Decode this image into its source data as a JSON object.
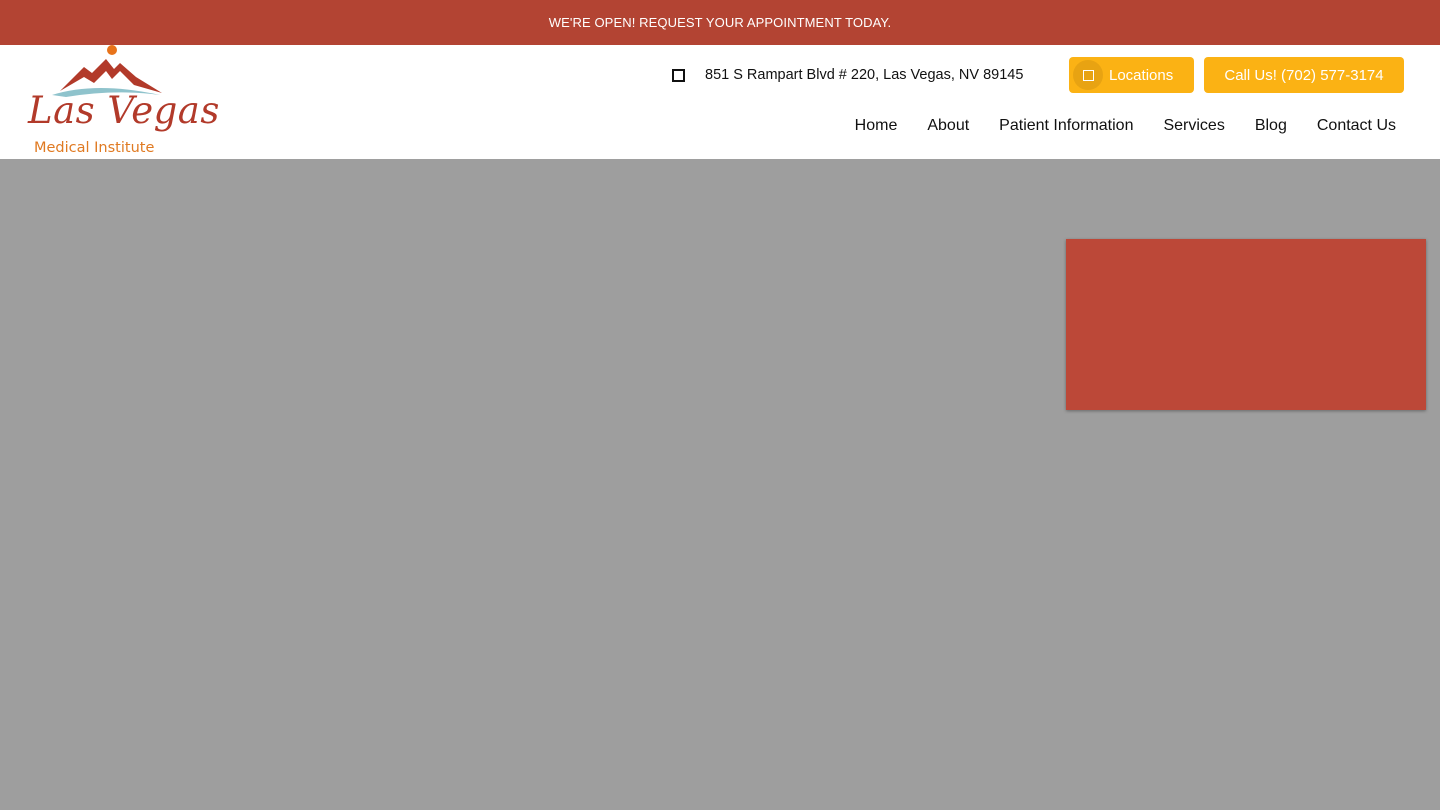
{
  "banner": {
    "text": "WE'RE OPEN! REQUEST YOUR APPOINTMENT TODAY."
  },
  "logo": {
    "script": "Las Vegas",
    "sub": "Medical Institute",
    "colors": {
      "script": "#b23a2a",
      "sub": "#e07a22",
      "mountain": "#b23a2a",
      "wave": "#8fc3cc",
      "sun": "#e8731a"
    }
  },
  "header": {
    "address_icon": "map-marker-icon",
    "address": "851 S Rampart Blvd # 220, Las Vegas, NV 89145",
    "locations_label": "Locations",
    "locations_icon": "location-icon",
    "call_label": "Call Us! (702) 577-3174"
  },
  "nav": {
    "items": [
      {
        "label": "Home"
      },
      {
        "label": "About"
      },
      {
        "label": "Patient Information"
      },
      {
        "label": "Services"
      },
      {
        "label": "Blog"
      },
      {
        "label": "Contact Us"
      }
    ]
  },
  "colors": {
    "banner": "#b34433",
    "button": "#fbb214",
    "hero": "#9e9e9e",
    "panel": "#bc4838"
  }
}
